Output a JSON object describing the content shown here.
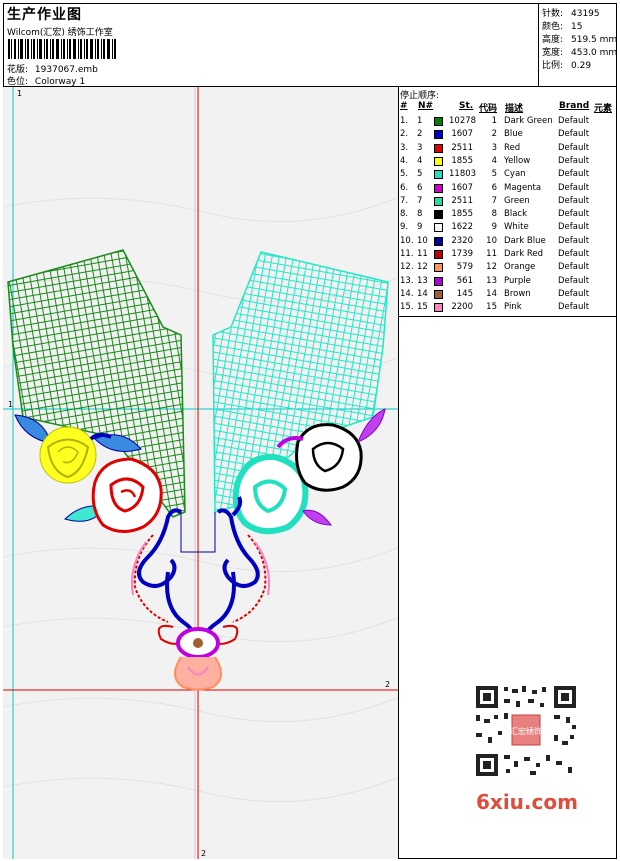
{
  "header": {
    "title": "生产作业图",
    "subtitle": "Wilcom(汇宏) 绣饰工作室",
    "design_label": "花版:",
    "design_file": "1937067.emb",
    "colorway_label": "色位:",
    "colorway": "Colorway 1"
  },
  "stats": [
    {
      "label": "针数:",
      "value": "43195"
    },
    {
      "label": "颜色:",
      "value": "15"
    },
    {
      "label": "高度:",
      "value": "519.5 mm"
    },
    {
      "label": "宽度:",
      "value": "453.0 mm"
    },
    {
      "label": "比例:",
      "value": "0.29"
    }
  ],
  "guides": {
    "top_left": "1",
    "left_mark": "1",
    "right_mark": "2",
    "bottom_mark": "2"
  },
  "stop_sequence": {
    "title": "停止顺序:",
    "columns": [
      "#",
      "N#",
      "St.",
      "代码",
      "描述",
      "Brand",
      "元素"
    ],
    "rows": [
      {
        "idx": "1.",
        "n": "1",
        "st": "10278",
        "code": "1",
        "desc": "Dark Green",
        "brand": "Default",
        "color": "#008000"
      },
      {
        "idx": "2.",
        "n": "2",
        "st": "1607",
        "code": "2",
        "desc": "Blue",
        "brand": "Default",
        "color": "#0000cc"
      },
      {
        "idx": "3.",
        "n": "3",
        "st": "2511",
        "code": "3",
        "desc": "Red",
        "brand": "Default",
        "color": "#e00000"
      },
      {
        "idx": "4.",
        "n": "4",
        "st": "1855",
        "code": "4",
        "desc": "Yellow",
        "brand": "Default",
        "color": "#ffff00"
      },
      {
        "idx": "5.",
        "n": "5",
        "st": "11803",
        "code": "5",
        "desc": "Cyan",
        "brand": "Default",
        "color": "#20e0c0"
      },
      {
        "idx": "6.",
        "n": "6",
        "st": "1607",
        "code": "6",
        "desc": "Magenta",
        "brand": "Default",
        "color": "#d000d0"
      },
      {
        "idx": "7.",
        "n": "7",
        "st": "2511",
        "code": "7",
        "desc": "Green",
        "brand": "Default",
        "color": "#20e0a0"
      },
      {
        "idx": "8.",
        "n": "8",
        "st": "1855",
        "code": "8",
        "desc": "Black",
        "brand": "Default",
        "color": "#000000"
      },
      {
        "idx": "9.",
        "n": "9",
        "st": "1622",
        "code": "9",
        "desc": "White",
        "brand": "Default",
        "color": "#f4f4f4"
      },
      {
        "idx": "10.",
        "n": "10",
        "st": "2320",
        "code": "10",
        "desc": "Dark Blue",
        "brand": "Default",
        "color": "#0000a0"
      },
      {
        "idx": "11.",
        "n": "11",
        "st": "1739",
        "code": "11",
        "desc": "Dark Red",
        "brand": "Default",
        "color": "#c00000"
      },
      {
        "idx": "12.",
        "n": "12",
        "st": "579",
        "code": "12",
        "desc": "Orange",
        "brand": "Default",
        "color": "#ff9060"
      },
      {
        "idx": "13.",
        "n": "13",
        "st": "561",
        "code": "13",
        "desc": "Purple",
        "brand": "Default",
        "color": "#b000e0"
      },
      {
        "idx": "14.",
        "n": "14",
        "st": "145",
        "code": "14",
        "desc": "Brown",
        "brand": "Default",
        "color": "#a06030"
      },
      {
        "idx": "15.",
        "n": "15",
        "st": "2200",
        "code": "15",
        "desc": "Pink",
        "brand": "Default",
        "color": "#ff80c0"
      }
    ]
  },
  "watermark": {
    "site": "6xiu.com",
    "qr_stamp": "汇宏绣饰"
  }
}
